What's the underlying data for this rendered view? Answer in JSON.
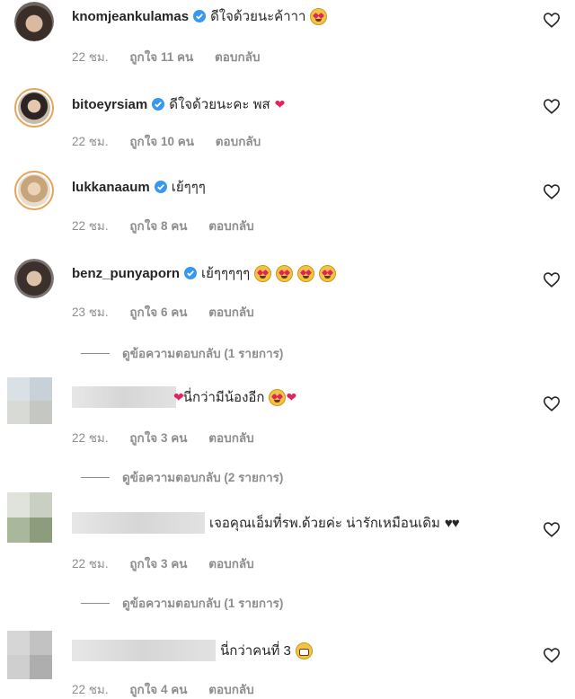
{
  "comments": [
    {
      "username": "knomjeankulamas",
      "verified": true,
      "text": "ดีใจด้วยนะค้าาา",
      "time": "22 ชม.",
      "likes": "ถูกใจ 11 คน",
      "reply": "ตอบกลับ"
    },
    {
      "username": "bitoeyrsiam",
      "verified": true,
      "text": "ดีใจด้วยนะคะ พส",
      "time": "22 ชม.",
      "likes": "ถูกใจ 10 คน",
      "reply": "ตอบกลับ"
    },
    {
      "username": "lukkanaaum",
      "verified": true,
      "text": "เย้ๆๆๆ",
      "time": "22 ชม.",
      "likes": "ถูกใจ 8 คน",
      "reply": "ตอบกลับ"
    },
    {
      "username": "benz_punyaporn",
      "verified": true,
      "text": "เย้ๆๆๆๆๆ",
      "time": "23 ชม.",
      "likes": "ถูกใจ 6 คน",
      "reply": "ตอบกลับ",
      "view_replies": "ดูข้อความตอบกลับ (1 รายการ)"
    },
    {
      "username": "",
      "verified": false,
      "text": "นี่กว่ามีน้องอีก",
      "time": "22 ชม.",
      "likes": "ถูกใจ 3 คน",
      "reply": "ตอบกลับ",
      "view_replies": "ดูข้อความตอบกลับ (2 รายการ)"
    },
    {
      "username": "",
      "verified": false,
      "text": "เจอคุณเอ็มที่รพ.ด้วยค่ะ น่ารักเหมือนเดิม",
      "time": "22 ชม.",
      "likes": "ถูกใจ 3 คน",
      "reply": "ตอบกลับ",
      "view_replies": "ดูข้อความตอบกลับ (1 รายการ)"
    },
    {
      "username": "",
      "verified": false,
      "text": "นี่กว่าคนที่ 3",
      "time": "22 ชม.",
      "likes": "ถูกใจ 4 คน",
      "reply": "ตอบกลับ"
    }
  ],
  "colors": {
    "ring": "#e8a35a",
    "verified": "#3897f0",
    "meta": "#8e8e8e"
  },
  "icons": {
    "like": "heart-outline-icon",
    "verified": "verified-badge-icon"
  }
}
